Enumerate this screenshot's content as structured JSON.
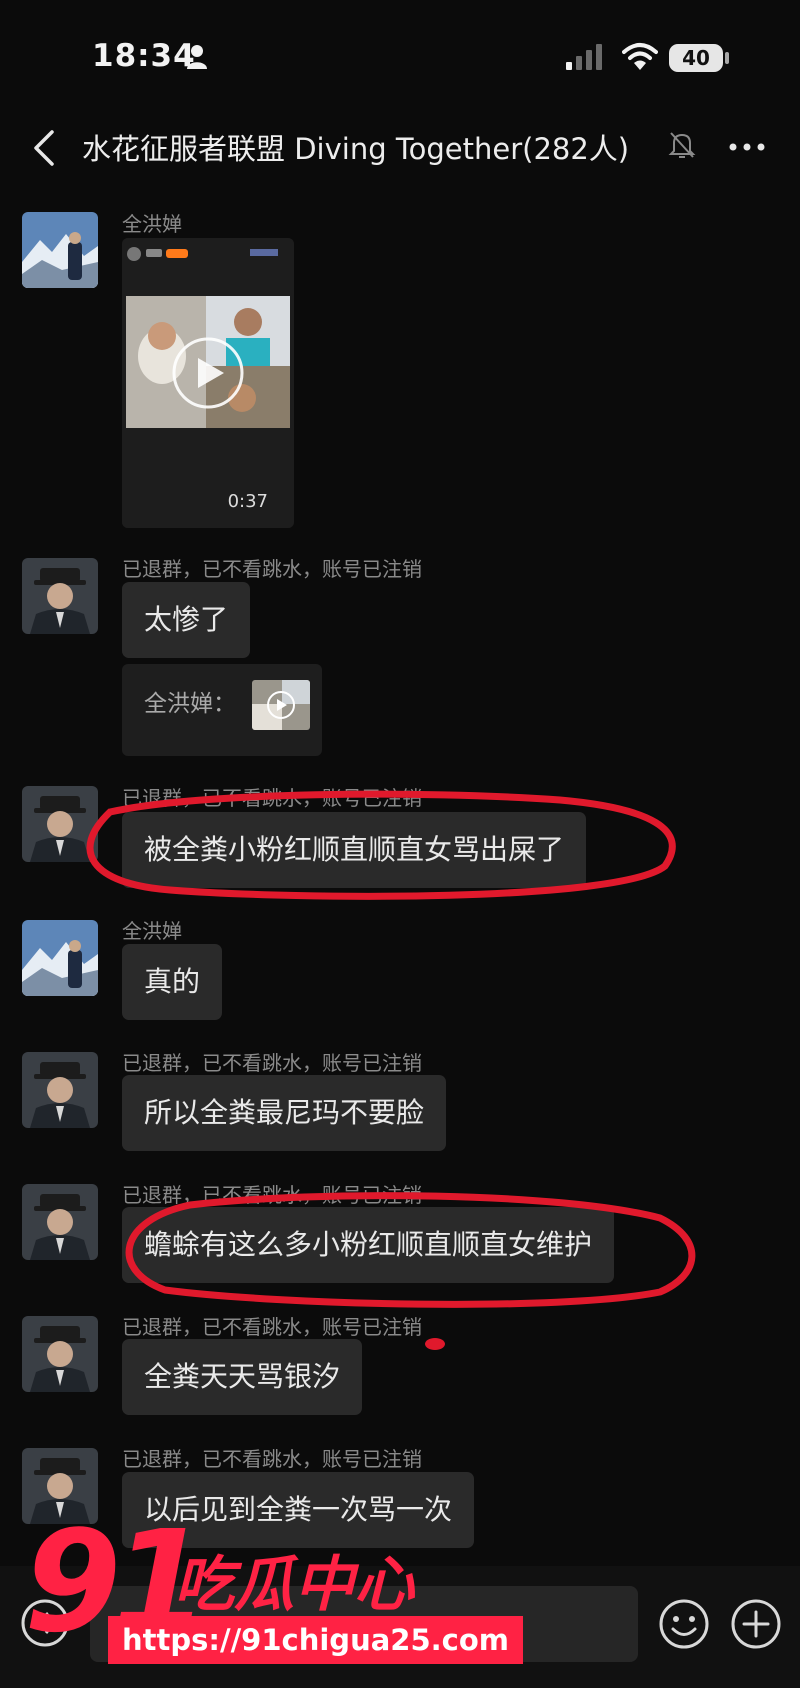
{
  "status_bar": {
    "time": "18:34",
    "battery": "40"
  },
  "header": {
    "title": "水花征服者联盟 Diving Together(282人)"
  },
  "messages": [
    {
      "sender": "全洪婵",
      "type": "video",
      "duration": "0:37"
    },
    {
      "sender": "已退群，已不看跳水，账号已注销",
      "text": "太惨了",
      "quote": "全洪婵："
    },
    {
      "sender": "已退群，已不看跳水，账号已注销",
      "text": "被全粪小粉红顺直顺直女骂出屎了"
    },
    {
      "sender": "全洪婵",
      "text": "真的"
    },
    {
      "sender": "已退群，已不看跳水，账号已注销",
      "text": "所以全粪最尼玛不要脸"
    },
    {
      "sender": "已退群，已不看跳水，账号已注销",
      "text": "蟾蜍有这么多小粉红顺直顺直女维护"
    },
    {
      "sender": "已退群，已不看跳水，账号已注销",
      "text": "全粪天天骂银汐"
    },
    {
      "sender": "已退群，已不看跳水，账号已注销",
      "text": "以后见到全粪一次骂一次"
    }
  ],
  "watermark": {
    "number": "91",
    "name": "吃瓜中心",
    "url": "https://91chigua25.com"
  },
  "colors": {
    "background": "#0b0b0b",
    "bubble": "#2a2a2a",
    "annotation": "#e0192c",
    "watermark": "#ff2244"
  },
  "icons": [
    "person-icon",
    "signal-icon",
    "wifi-icon",
    "back-icon",
    "mute-icon",
    "more-icon",
    "play-icon",
    "voice-icon",
    "emoji-icon",
    "plus-icon"
  ]
}
